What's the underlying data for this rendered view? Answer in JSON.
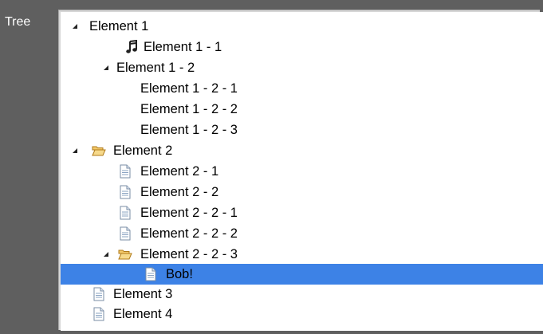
{
  "sidebar": {
    "label": "Tree"
  },
  "tree": {
    "rows": [
      {
        "label": "Element 1",
        "icon": "none",
        "expanded": true,
        "selected": false
      },
      {
        "label": "Element 1 - 1",
        "icon": "music-note-icon",
        "expanded": null,
        "selected": false
      },
      {
        "label": "Element 1 - 2",
        "icon": "none",
        "expanded": true,
        "selected": false
      },
      {
        "label": "Element 1 - 2 - 1",
        "icon": "none",
        "expanded": null,
        "selected": false
      },
      {
        "label": "Element 1 - 2 - 2",
        "icon": "none",
        "expanded": null,
        "selected": false
      },
      {
        "label": "Element 1 - 2 - 3",
        "icon": "none",
        "expanded": null,
        "selected": false
      },
      {
        "label": "Element 2",
        "icon": "folder-open-icon",
        "expanded": true,
        "selected": false
      },
      {
        "label": "Element 2 - 1",
        "icon": "document-icon",
        "expanded": null,
        "selected": false
      },
      {
        "label": "Element 2 - 2",
        "icon": "document-icon",
        "expanded": null,
        "selected": false
      },
      {
        "label": "Element 2 - 2 - 1",
        "icon": "document-icon",
        "expanded": null,
        "selected": false
      },
      {
        "label": "Element 2 - 2 - 2",
        "icon": "document-icon",
        "expanded": null,
        "selected": false
      },
      {
        "label": "Element 2 - 2 - 3",
        "icon": "folder-open-icon",
        "expanded": true,
        "selected": false
      },
      {
        "label": "Bob!",
        "icon": "document-icon",
        "expanded": null,
        "selected": true
      },
      {
        "label": "Element 3",
        "icon": "document-icon",
        "expanded": null,
        "selected": false
      },
      {
        "label": "Element 4",
        "icon": "document-icon",
        "expanded": null,
        "selected": false
      }
    ]
  },
  "colors": {
    "selection": "#3d82e6",
    "background": "#5f5f5f",
    "tree_background": "#ffffff"
  }
}
